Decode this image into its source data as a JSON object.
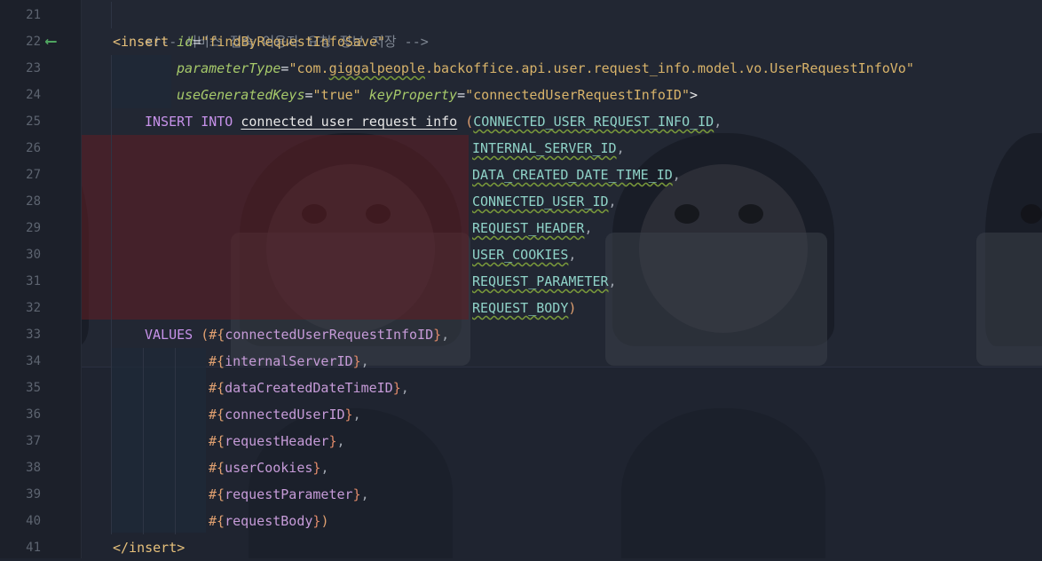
{
  "editor": {
    "line_numbers": [
      "21",
      "22",
      "23",
      "24",
      "25",
      "26",
      "27",
      "28",
      "29",
      "30",
      "31",
      "32",
      "33",
      "34",
      "35",
      "36",
      "37",
      "38",
      "39",
      "40",
      "41"
    ],
    "gutter_arrow": "⟵",
    "comment": "<!-- 서비스 접속 이용자 요청 정보 저장 -->",
    "insert_open": "<insert",
    "id_attr": "id",
    "id_value": "\"findByRequestInfoSave\"",
    "param_attr": "parameterType",
    "param_value_pre": "\"com.",
    "param_value_squig": "giggalpeople",
    "param_value_post": ".backoffice.api.user.request_info.model.vo.UserRequestInfoVo\"",
    "gen_attr": "useGeneratedKeys",
    "gen_value": "\"true\"",
    "key_attr": "keyProperty",
    "key_value": "\"connectedUserRequestInfoID\"",
    "gt": ">",
    "insert_kw": "INSERT INTO",
    "table_name": "connected_user_request_info",
    "open_paren": "(",
    "columns": [
      "CONNECTED_USER_REQUEST_INFO_ID",
      "INTERNAL_SERVER_ID",
      "DATA_CREATED_DATE_TIME_ID",
      "CONNECTED_USER_ID",
      "REQUEST_HEADER",
      "USER_COOKIES",
      "REQUEST_PARAMETER",
      "REQUEST_BODY"
    ],
    "comma": ",",
    "close_paren": ")",
    "values_kw": "VALUES",
    "params": [
      "connectedUserRequestInfoID",
      "internalServerID",
      "dataCreatedDateTimeID",
      "connectedUserID",
      "requestHeader",
      "userCookies",
      "requestParameter",
      "requestBody"
    ],
    "hash_open": "#{",
    "brace_close": "}",
    "insert_close": "</insert>"
  },
  "colors": {
    "background": "#1f2430",
    "tag": "#e6c07b",
    "attribute": "#a6c96a",
    "string": "#d8b36a",
    "keyword": "#c792ea",
    "column": "#8fd3c8",
    "param": "#c69bd8",
    "gutter_arrow": "#4fa560"
  }
}
